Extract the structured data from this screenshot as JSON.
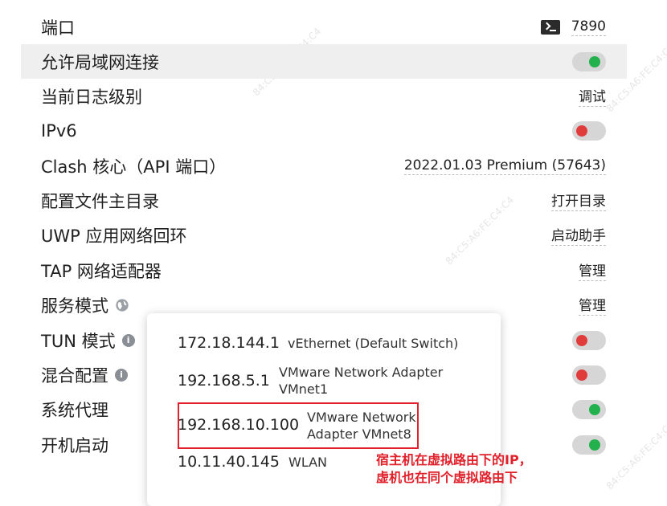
{
  "settings": {
    "port": {
      "label": "端口",
      "value": "7890"
    },
    "allow_lan": {
      "label": "允许局域网连接",
      "state": "on"
    },
    "log_level": {
      "label": "当前日志级别",
      "value": "调试"
    },
    "ipv6": {
      "label": "IPv6",
      "state": "off"
    },
    "clash_core": {
      "label": "Clash 核心（API 端口）",
      "value": "2022.01.03 Premium (57643)"
    },
    "config_dir": {
      "label": "配置文件主目录",
      "value": "打开目录"
    },
    "uwp_loopback": {
      "label": "UWP 应用网络回环",
      "value": "启动助手"
    },
    "tap_adapter": {
      "label": "TAP 网络适配器",
      "value": "管理"
    },
    "service_mode": {
      "label": "服务模式",
      "value": "管理"
    },
    "tun_mode": {
      "label": "TUN 模式",
      "state": "off"
    },
    "mixin": {
      "label": "混合配置",
      "state": "off"
    },
    "system_proxy": {
      "label": "系统代理",
      "state": "on"
    },
    "startup": {
      "label": "开机启动",
      "state": "on"
    }
  },
  "popup": {
    "items": [
      {
        "ip": "172.18.144.1",
        "adapter": "vEthernet (Default Switch)"
      },
      {
        "ip": "192.168.5.1",
        "adapter_line1": "VMware Network Adapter",
        "adapter_line2": "VMnet1"
      },
      {
        "ip": "192.168.10.100",
        "adapter_line1": "VMware Network",
        "adapter_line2": "Adapter VMnet8"
      },
      {
        "ip": "10.11.40.145",
        "adapter": "WLAN"
      }
    ]
  },
  "annotation": {
    "line1": "宿主机在虚拟路由下的IP，",
    "line2": "虚机也在同个虚拟路由下"
  },
  "watermark": "84:C5:A6:FE:C4:C4",
  "colors": {
    "toggle_on": "#22b14c",
    "toggle_off": "#e03c3c",
    "annotation_red": "#e0202a",
    "highlight_bg": "#efefef"
  },
  "icons": {
    "port": "terminal-icon",
    "service_mode": "globe-icon",
    "tun_mode": "info-icon",
    "mixin": "info-icon"
  }
}
